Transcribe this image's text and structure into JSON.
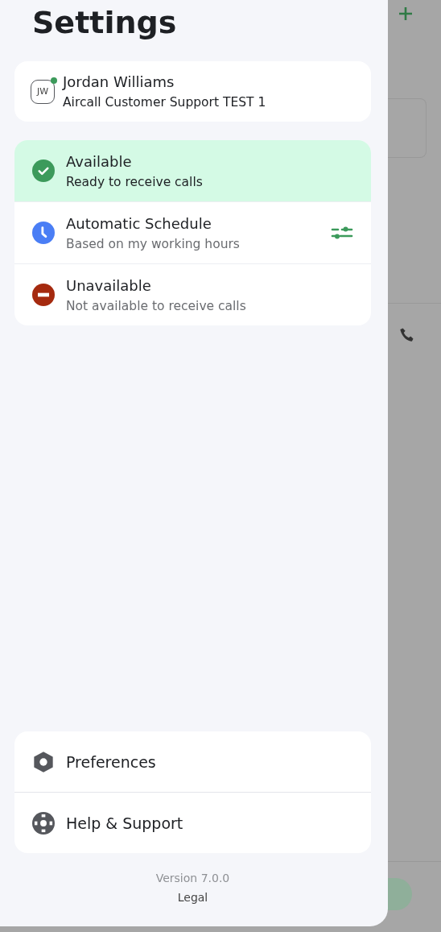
{
  "title": "Settings",
  "profile": {
    "initials": "JW",
    "online": true,
    "name": "Jordan Williams",
    "company": "Aircall Customer Support TEST 1"
  },
  "statuses": [
    {
      "kind": "available",
      "label": "Available",
      "description": "Ready to receive calls",
      "selected": true
    },
    {
      "kind": "schedule",
      "label": "Automatic Schedule",
      "description": "Based on my working hours",
      "selected": false
    },
    {
      "kind": "unavailable",
      "label": "Unavailable",
      "description": "Not available to receive calls",
      "selected": false
    }
  ],
  "menu": [
    {
      "kind": "preferences",
      "label": "Preferences"
    },
    {
      "kind": "help",
      "label": "Help & Support"
    }
  ],
  "version": "Version 7.0.0",
  "legal": "Legal"
}
